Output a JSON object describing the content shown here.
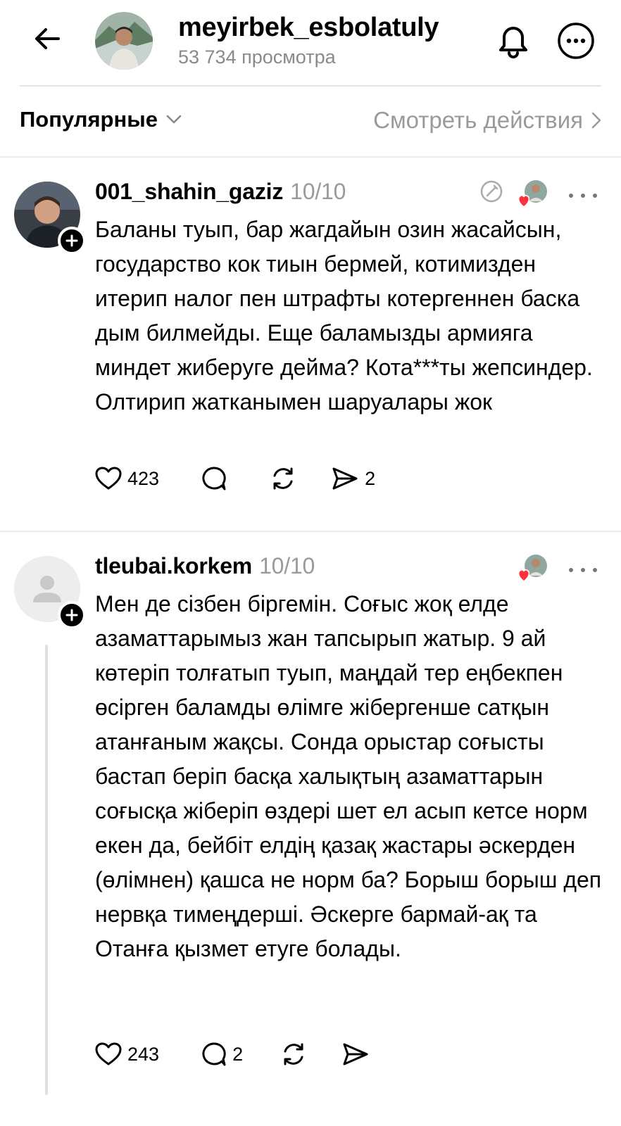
{
  "header": {
    "username": "meyirbek_esbolatuly",
    "views": "53 734 просмотра"
  },
  "sortbar": {
    "sort_label": "Популярные",
    "activity_label": "Смотреть действия"
  },
  "posts": [
    {
      "username": "001_shahin_gaziz",
      "date": "10/10",
      "text": "Баланы туып, бар жагдайын озин жасайсын, государство кок тиын бермей, котимизден итерип налог пен штрафты котергеннен баска дым билмейды. Еще баламызды армияга миндет жибеpуге дейма? Кота***ты жепсиндер. Олтирип жатканымен шаруалары жок",
      "likes": "423",
      "replies": "",
      "shares": "2"
    },
    {
      "username": "tleubai.korkem",
      "date": "10/10",
      "text": "Мен де сізбен біргемін. Соғыс жоқ елде азаматтарымыз жан тапсырып жатыр. 9 ай көтеріп толғатып туып, маңдай тер еңбекпен өсірген баламды өлімге жібергенше сатқын атанғаным жақсы. Сонда орыстар соғысты бастап беріп басқа халықтың азаматтарын соғысқа жіберіп өздері шет ел асып кетсе норм екен да, бейбіт елдің қазақ жастары әскерден (өлімнен) қашса не норм ба? Борыш борыш деп нервқа тимеңдерші. Әскерге бармай-ақ та Отанға қызмет етуге болады.",
      "likes": "243",
      "replies": "2",
      "shares": ""
    }
  ],
  "colors": {
    "accent_heart": "#ff3040",
    "muted_text": "#9a9a9a",
    "divider": "#ececec"
  },
  "icons": [
    "back-arrow-icon",
    "bell-icon",
    "more-circle-icon",
    "chevron-down-icon",
    "chevron-right-icon",
    "heart-icon",
    "comment-icon",
    "repost-icon",
    "share-icon",
    "edited-icon",
    "plus-icon",
    "default-user-icon"
  ]
}
